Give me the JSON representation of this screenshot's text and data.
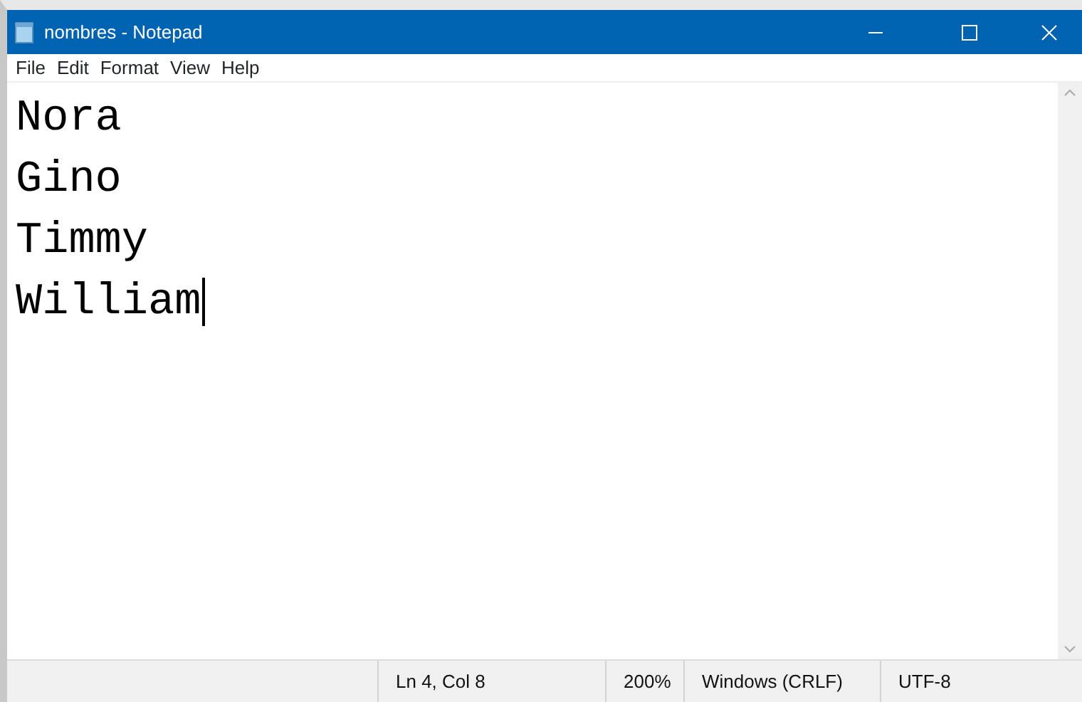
{
  "window": {
    "title": "nombres - Notepad"
  },
  "menu": [
    "File",
    "Edit",
    "Format",
    "View",
    "Help"
  ],
  "editor": {
    "lines": [
      "Nora",
      "Gino",
      "Timmy",
      "William"
    ]
  },
  "status_bar": {
    "position": "Ln 4, Col 8",
    "zoom": "200%",
    "line_ending": "Windows (CRLF)",
    "encoding": "UTF-8"
  }
}
